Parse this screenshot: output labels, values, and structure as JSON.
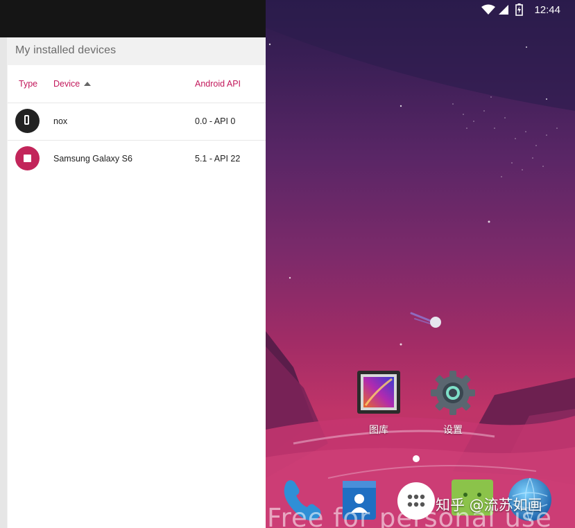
{
  "devices_panel": {
    "title": "My installed devices",
    "columns": {
      "type": "Type",
      "device": "Device",
      "android_api": "Android API"
    },
    "rows": [
      {
        "type_icon": "phone-icon",
        "type_color": "#222222",
        "device": "nox",
        "android_api": "0.0 - API 0"
      },
      {
        "type_icon": "stop-icon",
        "type_color": "#c2255a",
        "device": "Samsung Galaxy S6",
        "android_api": "5.1 - API 22"
      }
    ]
  },
  "emulator": {
    "status_bar": {
      "time": "12:44",
      "icons": [
        "wifi-icon",
        "signal-icon",
        "battery-charging-icon"
      ]
    },
    "home_apps": [
      {
        "label": "图库",
        "icon": "gallery-icon"
      },
      {
        "label": "设置",
        "icon": "settings-icon"
      }
    ],
    "dock": [
      "phone-app-icon",
      "contacts-app-icon",
      "app-drawer-icon",
      "messaging-app-icon",
      "browser-app-icon"
    ],
    "watermarks": {
      "overlay": "知乎 @流苏如画",
      "bottom": "Free for personal use"
    }
  },
  "colors": {
    "accent": "#c2185b",
    "top_bar": "#151515"
  }
}
